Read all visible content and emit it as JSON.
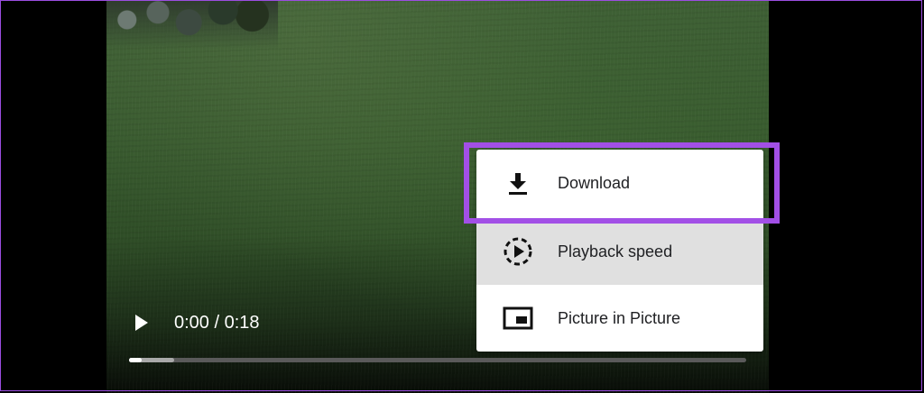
{
  "player": {
    "time_display": "0:00 / 0:18",
    "progress": {
      "played_fraction": 0.02,
      "buffered_fraction": 0.073
    }
  },
  "menu": {
    "items": [
      {
        "label": "Download",
        "icon": "download-icon"
      },
      {
        "label": "Playback speed",
        "icon": "playback-speed-icon"
      },
      {
        "label": "Picture in Picture",
        "icon": "picture-in-picture-icon"
      }
    ],
    "hovered_item": "Playback speed",
    "highlighted_item": "Download"
  },
  "colors": {
    "highlight": "#a24fe6",
    "menu_bg": "#ffffff",
    "hover_bg": "#e0e0e0",
    "page_bg": "#000000"
  }
}
